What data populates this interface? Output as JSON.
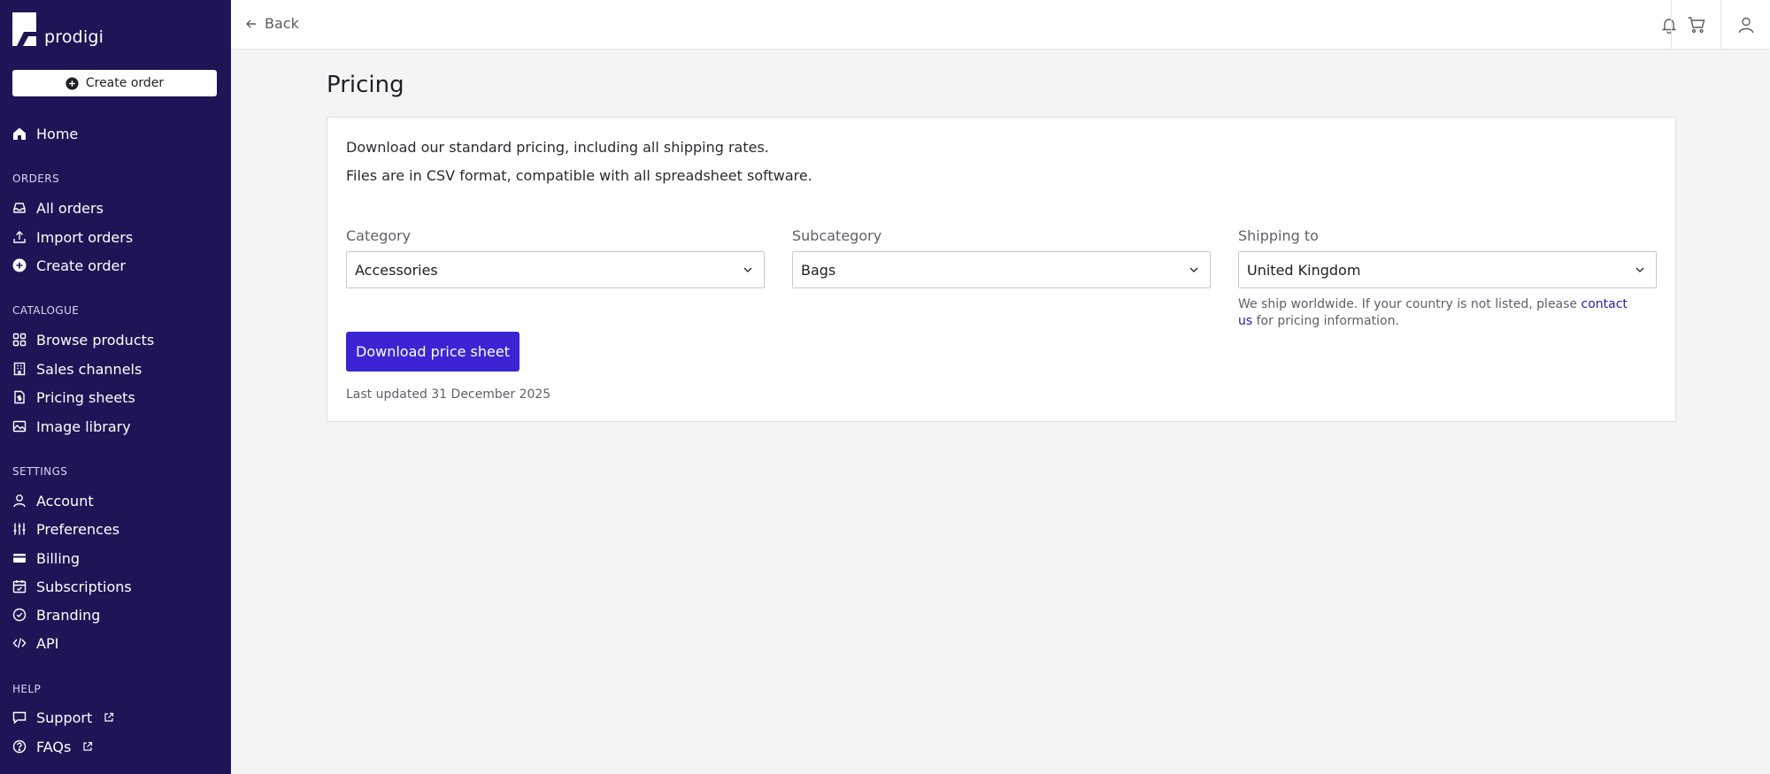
{
  "brand": {
    "name": "prodigi",
    "accent": "#3b24d4",
    "sidebar_bg": "#1e1556"
  },
  "sidebar": {
    "create_order_label": "Create order",
    "home": {
      "label": "Home",
      "icon": "home-icon"
    },
    "sections": {
      "orders": "ORDERS",
      "catalogue": "CATALOGUE",
      "settings": "SETTINGS",
      "help": "HELP"
    },
    "orders_items": [
      {
        "label": "All orders",
        "icon": "inbox-icon"
      },
      {
        "label": "Import orders",
        "icon": "upload-icon"
      },
      {
        "label": "Create order",
        "icon": "plus-circle-icon"
      }
    ],
    "catalogue_items": [
      {
        "label": "Browse products",
        "icon": "grid-icon"
      },
      {
        "label": "Sales channels",
        "icon": "building-icon"
      },
      {
        "label": "Pricing sheets",
        "icon": "dollar-file-icon"
      },
      {
        "label": "Image library",
        "icon": "image-icon"
      }
    ],
    "settings_items": [
      {
        "label": "Account",
        "icon": "user-icon"
      },
      {
        "label": "Preferences",
        "icon": "sliders-icon"
      },
      {
        "label": "Billing",
        "icon": "credit-card-icon"
      },
      {
        "label": "Subscriptions",
        "icon": "calendar-icon"
      },
      {
        "label": "Branding",
        "icon": "badge-check-icon"
      },
      {
        "label": "API",
        "icon": "code-icon"
      }
    ],
    "help_items": [
      {
        "label": "Support",
        "icon": "chat-icon"
      },
      {
        "label": "FAQs",
        "icon": "question-icon"
      }
    ]
  },
  "topbar": {
    "back_label": "Back",
    "icons": [
      "bell-icon",
      "cart-icon",
      "user-icon"
    ]
  },
  "main": {
    "title": "Pricing",
    "intro_line_1": "Download our standard pricing, including all shipping rates.",
    "intro_line_2": "Files are in CSV format, compatible with all spreadsheet software.",
    "category": {
      "label": "Category",
      "value": "Accessories"
    },
    "subcategory": {
      "label": "Subcategory",
      "value": "Bags"
    },
    "shipping": {
      "label": "Shipping to",
      "value": "United Kingdom"
    },
    "helper_before": "We ship worldwide. If your country is not listed, please ",
    "helper_link": "contact us",
    "helper_after": " for pricing information.",
    "download_label": "Download price sheet",
    "last_updated": "Last updated 31 December 2025"
  }
}
